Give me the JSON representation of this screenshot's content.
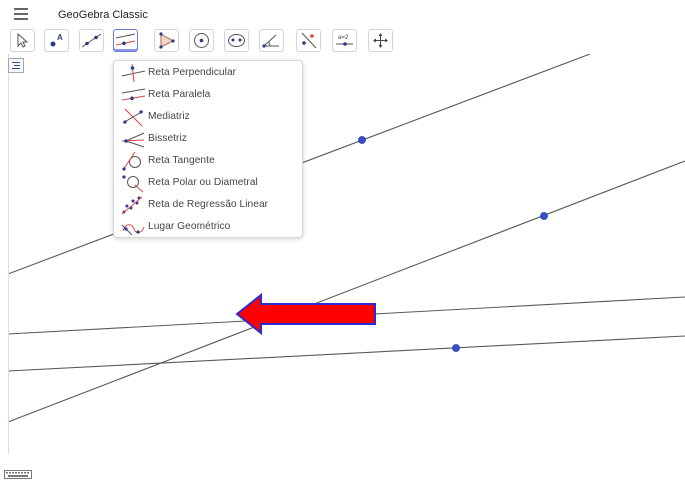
{
  "app": {
    "title": "GeoGebra Classic"
  },
  "toolbar": {
    "tools": [
      {
        "name": "move-tool"
      },
      {
        "name": "point-tool"
      },
      {
        "name": "line-tool"
      },
      {
        "name": "perpendicular-line-tool"
      },
      {
        "name": "polygon-tool"
      },
      {
        "name": "circle-tool"
      },
      {
        "name": "ellipse-tool"
      },
      {
        "name": "angle-tool"
      },
      {
        "name": "reflect-tool"
      },
      {
        "name": "slider-tool"
      },
      {
        "name": "move-graphics-view-tool"
      }
    ],
    "active_tool": "perpendicular-line-tool"
  },
  "submenu": {
    "items": [
      {
        "label": "Reta Perpendicular",
        "icon": "perpendicular-line-icon"
      },
      {
        "label": "Reta Paralela",
        "icon": "parallel-line-icon"
      },
      {
        "label": "Mediatriz",
        "icon": "perpendicular-bisector-icon"
      },
      {
        "label": "Bissetriz",
        "icon": "angle-bisector-icon"
      },
      {
        "label": "Reta Tangente",
        "icon": "tangents-icon"
      },
      {
        "label": "Reta Polar ou Diametral",
        "icon": "polar-line-icon"
      },
      {
        "label": "Reta de Regressão Linear",
        "icon": "best-fit-line-icon"
      },
      {
        "label": "Lugar Geométrico",
        "icon": "locus-icon"
      }
    ]
  },
  "colors": {
    "line": "#5a5a5a",
    "point": "#3a4fd0",
    "arrow_fill": "#ff0000",
    "arrow_border": "#2b2bd0",
    "accent": "#6b7bd6"
  }
}
